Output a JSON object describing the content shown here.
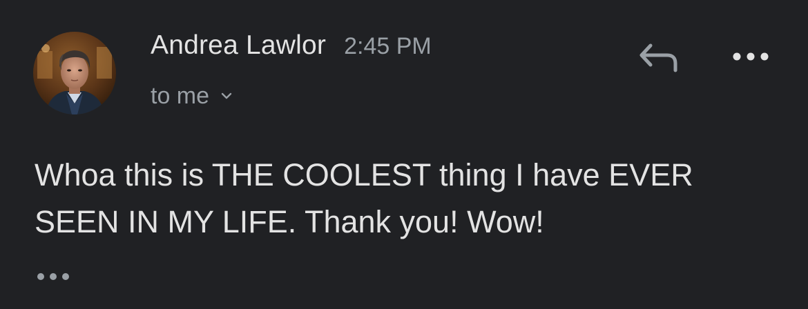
{
  "message": {
    "sender_name": "Andrea Lawlor",
    "time": "2:45 PM",
    "recipient_label": "to me",
    "body_line1": "Whoa this is THE COOLEST thing I have EVER",
    "body_line2": "SEEN IN MY LIFE. Thank you! Wow!"
  },
  "icons": {
    "reply": "reply-arrow-icon",
    "more": "more-options-icon",
    "expand": "chevron-down-icon",
    "trimmed": "show-trimmed-content-icon"
  },
  "colors": {
    "background": "#202124",
    "primary_text": "#e3e3e3",
    "secondary_text": "#9aa0a6"
  }
}
